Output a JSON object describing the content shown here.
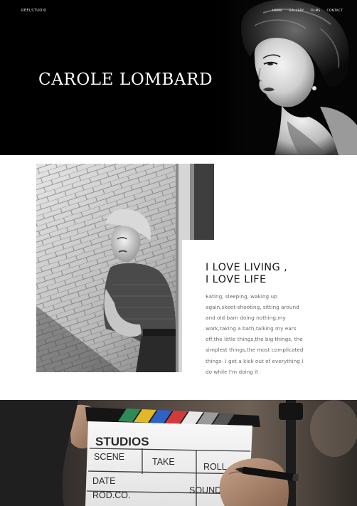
{
  "header": {
    "logo": "REELSTUDIO",
    "nav": [
      "HOME",
      "GALLERY",
      "FILMS",
      "CONTACT"
    ]
  },
  "hero": {
    "title": "CAROLE LOMBARD"
  },
  "about": {
    "heading_line1": "I LOVE LIVING ,",
    "heading_line2": "I LOVE LIFE",
    "body": "Eating, sleeping, waking up again,skeet-shooting, sitting around and old barn doing nothing,my work,taking a bath,talking my ears off,the little things,the big things, the simplest things,the most complicated things- I get a kick out of everything I do while I'm doing it"
  },
  "clapper": {
    "brand": "STUDIOS",
    "scene": "SCENE",
    "take": "TAKE",
    "roll": "ROLL",
    "date": "DATE",
    "prod": "ROD.CO.",
    "sound": "SOUND"
  }
}
